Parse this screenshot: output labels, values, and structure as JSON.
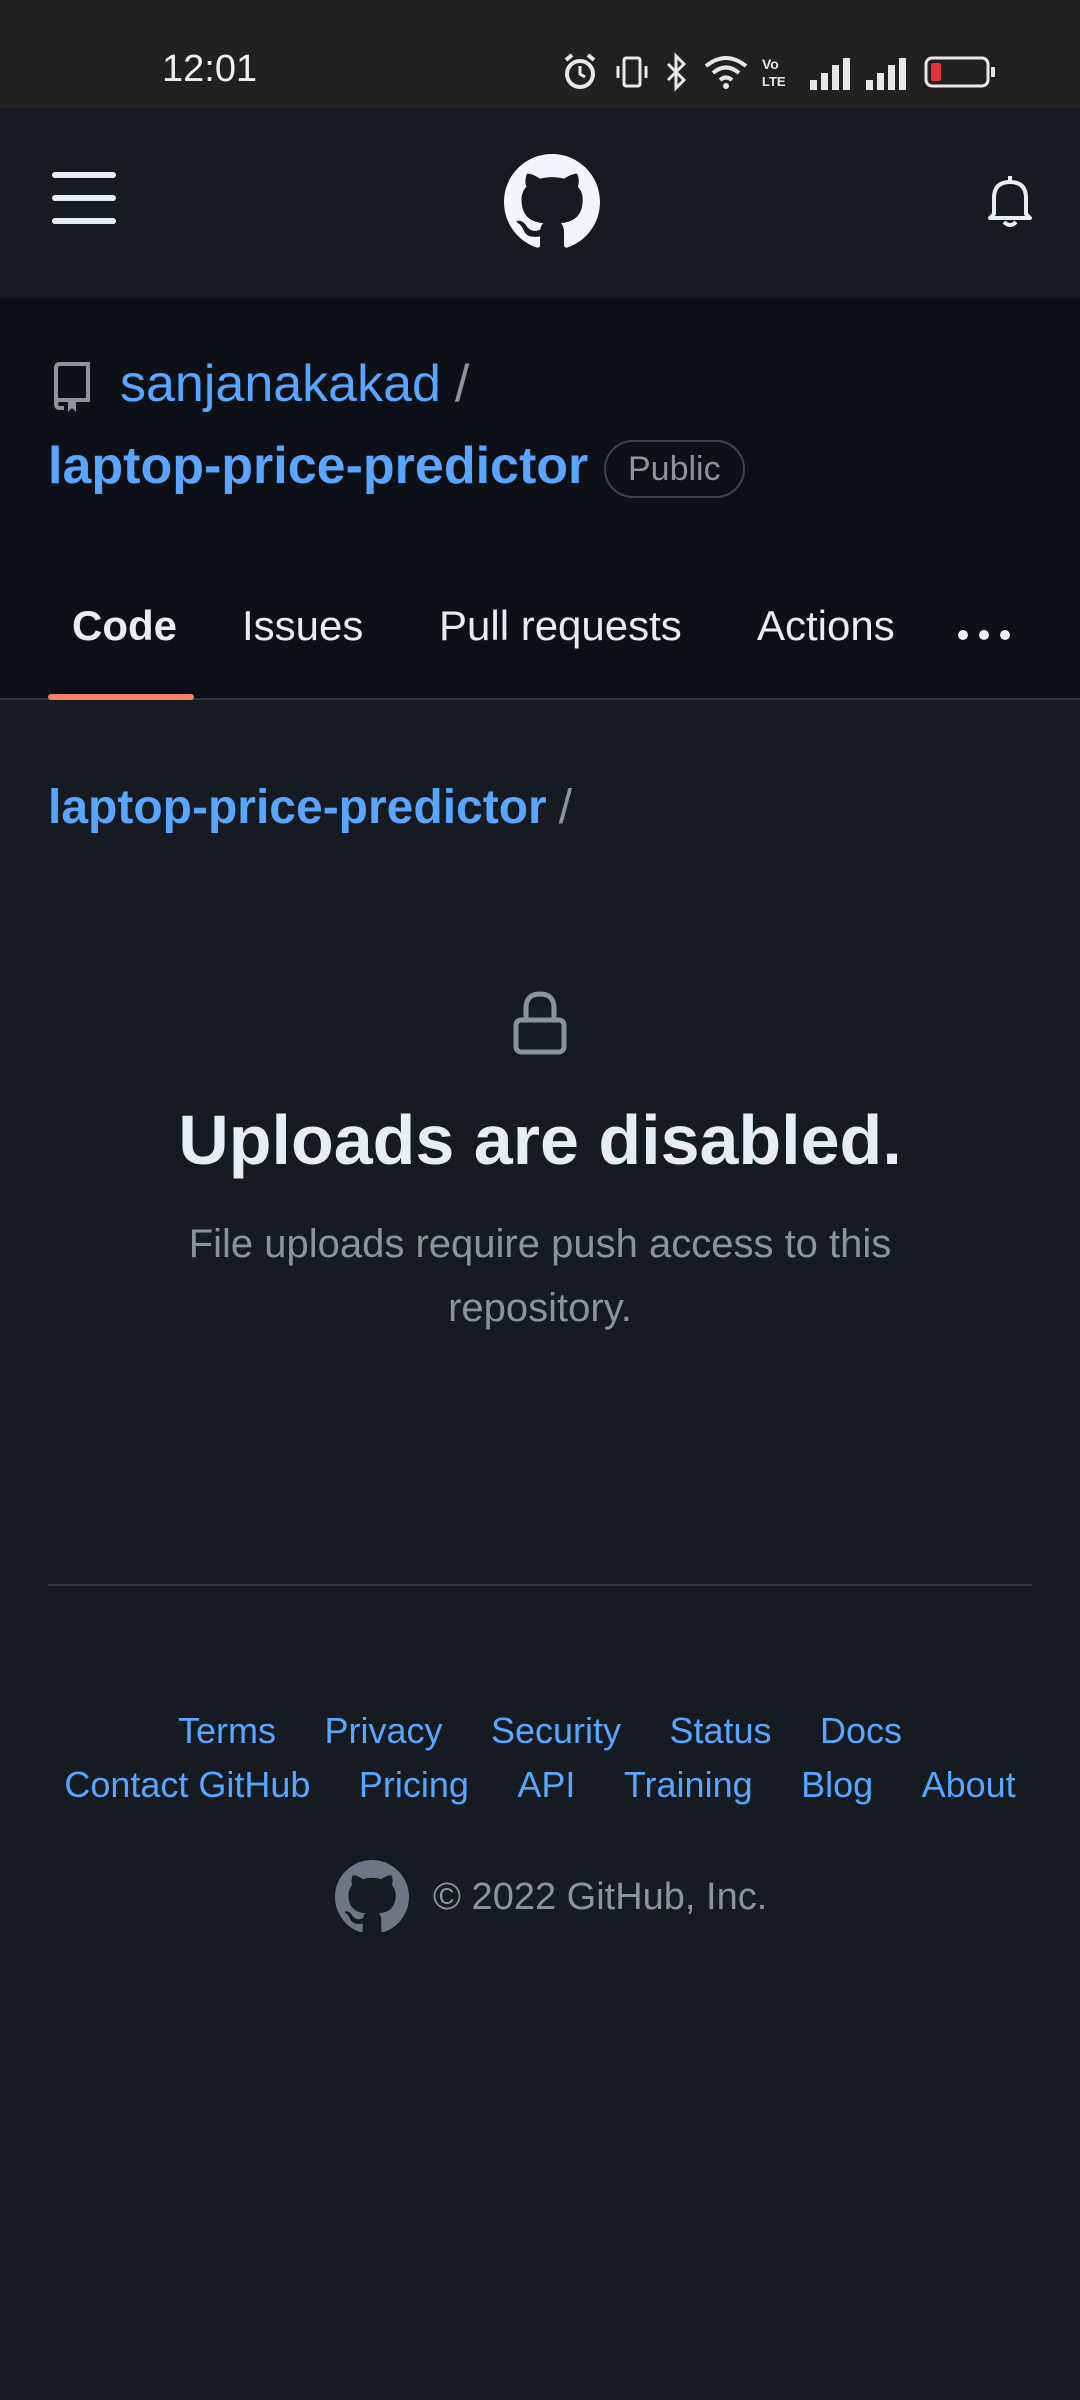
{
  "status_bar": {
    "time": "12:01"
  },
  "repo": {
    "owner": "sanjanakakad",
    "name": "laptop-price-predictor",
    "visibility": "Public"
  },
  "tabs": [
    {
      "label": "Code",
      "active": true
    },
    {
      "label": "Issues"
    },
    {
      "label": "Pull requests"
    },
    {
      "label": "Actions"
    }
  ],
  "breadcrumb": {
    "repo": "laptop-price-predictor",
    "separator": "/"
  },
  "empty_state": {
    "title": "Uploads are disabled.",
    "description": "File uploads require push access to this repository."
  },
  "footer": {
    "row1": [
      "Terms",
      "Privacy",
      "Security",
      "Status",
      "Docs"
    ],
    "row2": [
      "Contact GitHub",
      "Pricing",
      "API",
      "Training",
      "Blog",
      "About"
    ],
    "copyright": "© 2022 GitHub, Inc."
  },
  "colors": {
    "link": "#58a6ff",
    "tab_underline": "#f78166",
    "background": "#161b22",
    "battery_low": "#e5333b"
  }
}
